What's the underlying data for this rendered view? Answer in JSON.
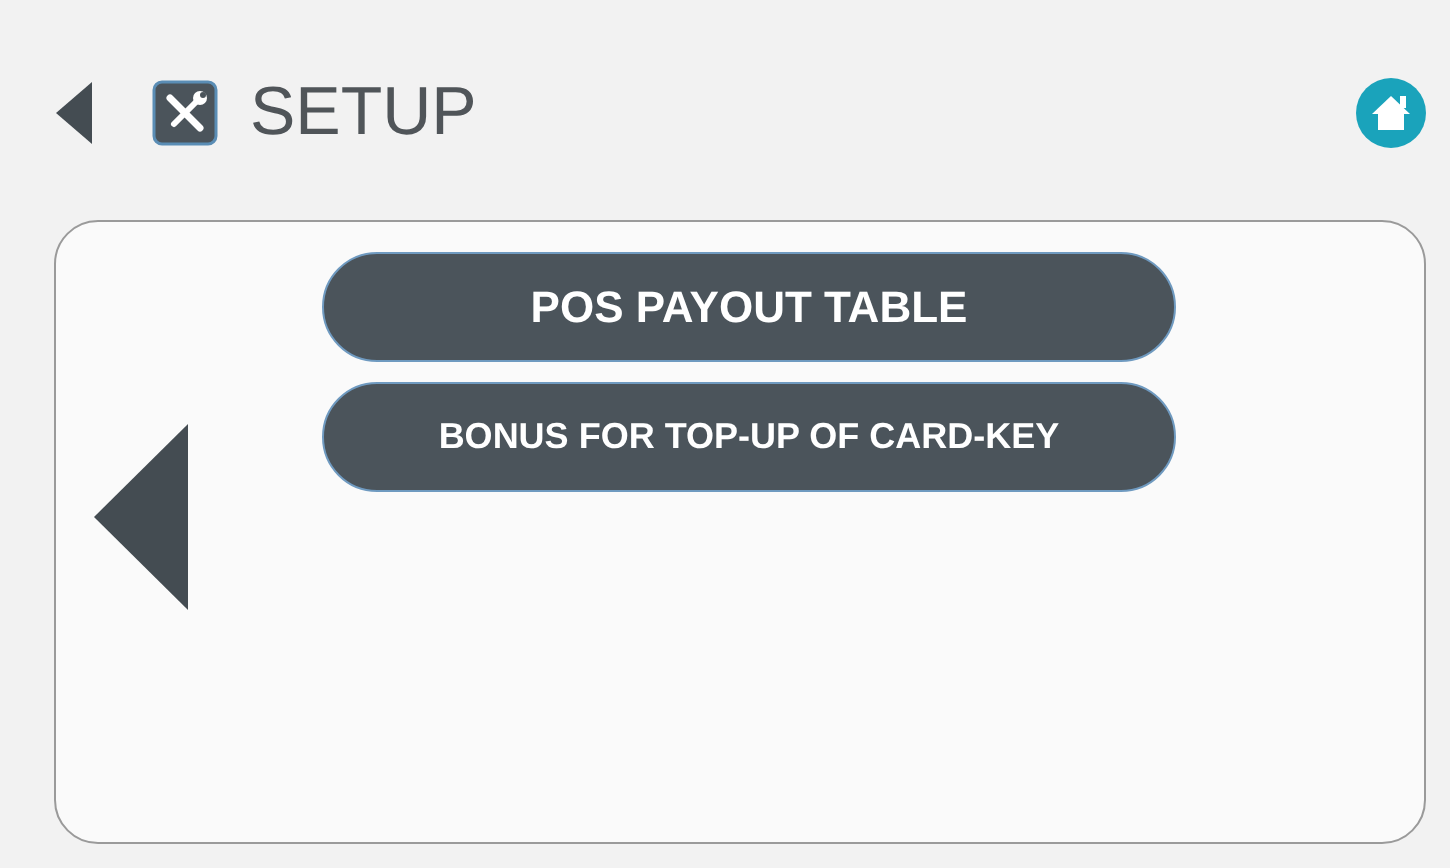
{
  "header": {
    "title": "SETUP"
  },
  "menu": [
    {
      "label": "POS PAYOUT TABLE",
      "kind": "large"
    },
    {
      "label": "BONUS FOR TOP-UP OF CARD-KEY",
      "kind": "small"
    }
  ]
}
